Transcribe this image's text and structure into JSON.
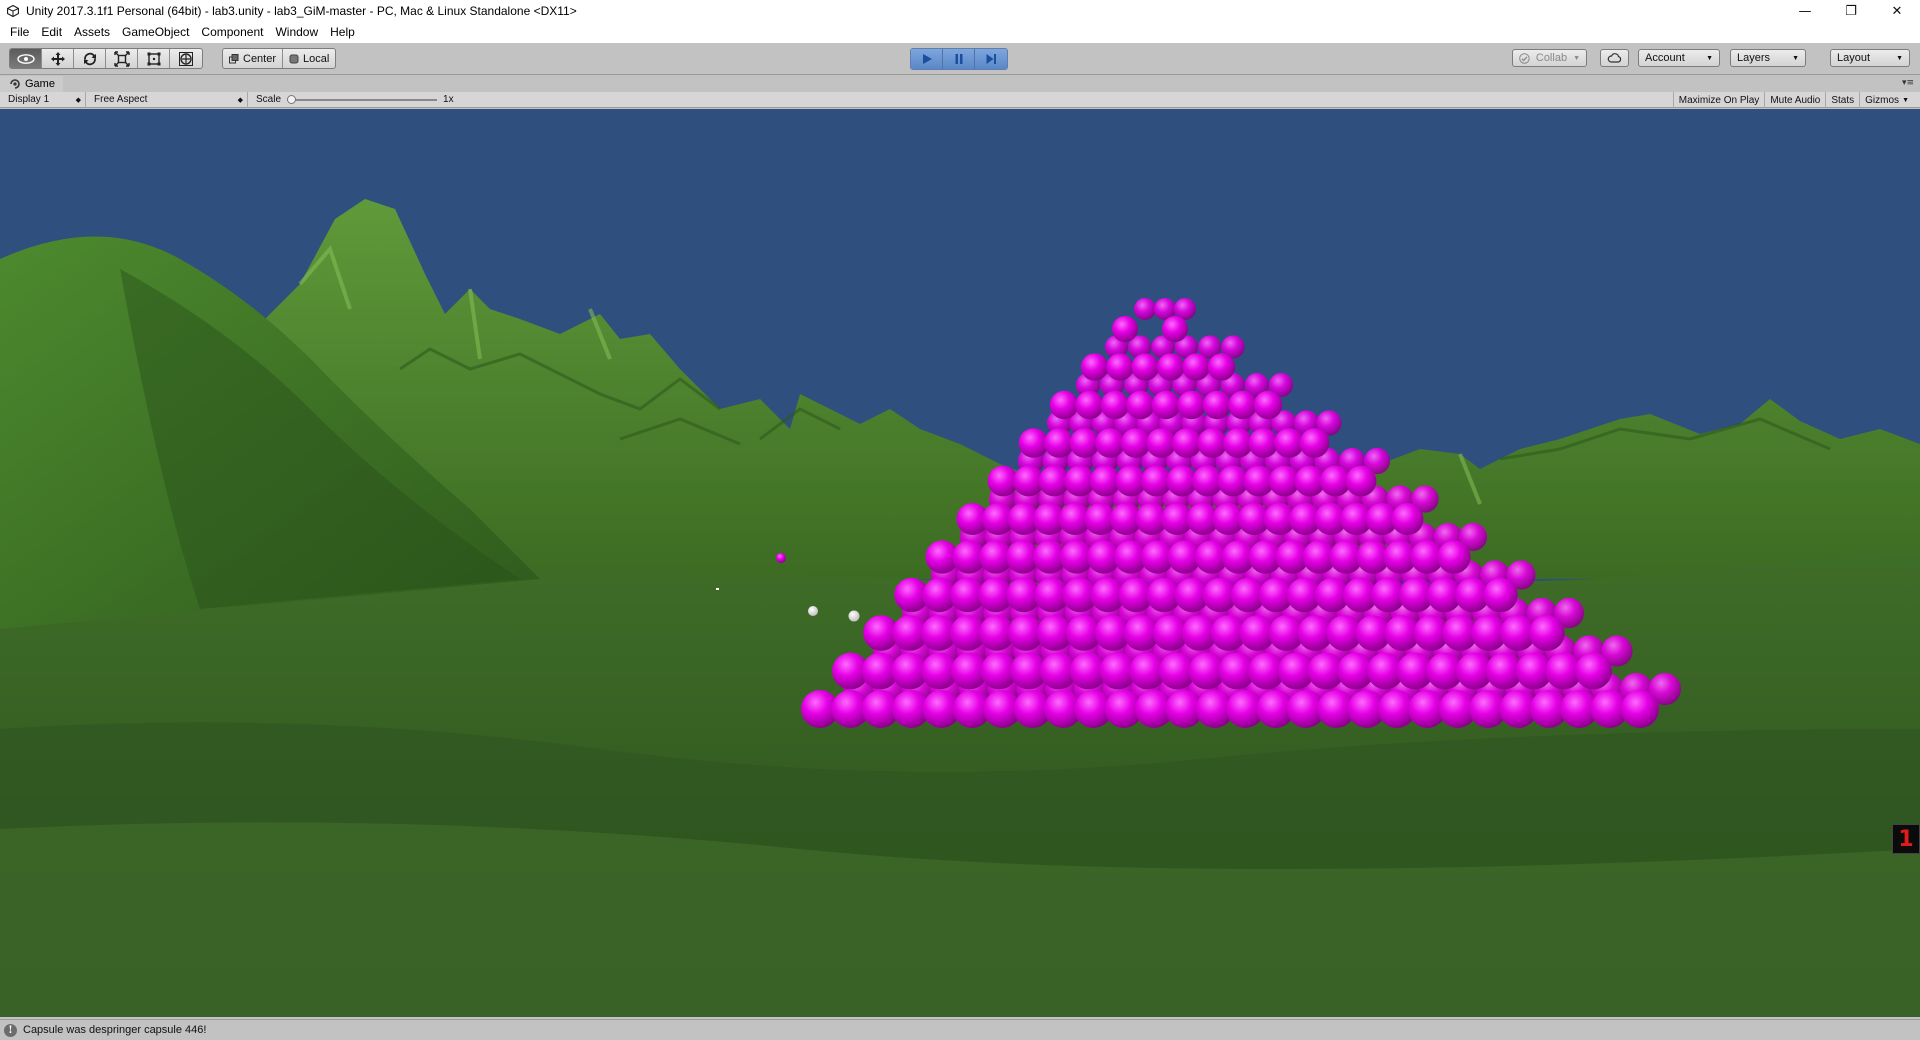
{
  "window": {
    "title": "Unity 2017.3.1f1 Personal (64bit) - lab3.unity - lab3_GiM-master - PC, Mac & Linux Standalone <DX11>",
    "controls": {
      "minimize": "—",
      "restore": "❐",
      "close": "✕"
    }
  },
  "menu": {
    "items": [
      "File",
      "Edit",
      "Assets",
      "GameObject",
      "Component",
      "Window",
      "Help"
    ]
  },
  "toolbar": {
    "tools": [
      {
        "icon": "eye-icon",
        "active": true
      },
      {
        "icon": "move-icon",
        "active": false
      },
      {
        "icon": "rotate-icon",
        "active": false
      },
      {
        "icon": "scale-icon",
        "active": false
      },
      {
        "icon": "rect-tool-icon",
        "active": false
      },
      {
        "icon": "transform-tool-icon",
        "active": false
      }
    ],
    "pivot_label": "Center",
    "space_label": "Local",
    "play_state": "playing",
    "collab_label": "Collab",
    "account_label": "Account",
    "layers_label": "Layers",
    "layout_label": "Layout"
  },
  "game_tab": {
    "label": "Game",
    "display": "Display 1",
    "aspect": "Free Aspect",
    "scale_label": "Scale",
    "scale_value": "1x",
    "toggles": [
      "Maximize On Play",
      "Mute Audio",
      "Stats",
      "Gizmos"
    ]
  },
  "game_view": {
    "sky_color": "#2f4f7e",
    "grass_color": "#3f6e27",
    "sphere_color": "#e600e6",
    "counter_text": "1"
  },
  "status": {
    "message": "Capsule was despringer capsule 446!"
  }
}
